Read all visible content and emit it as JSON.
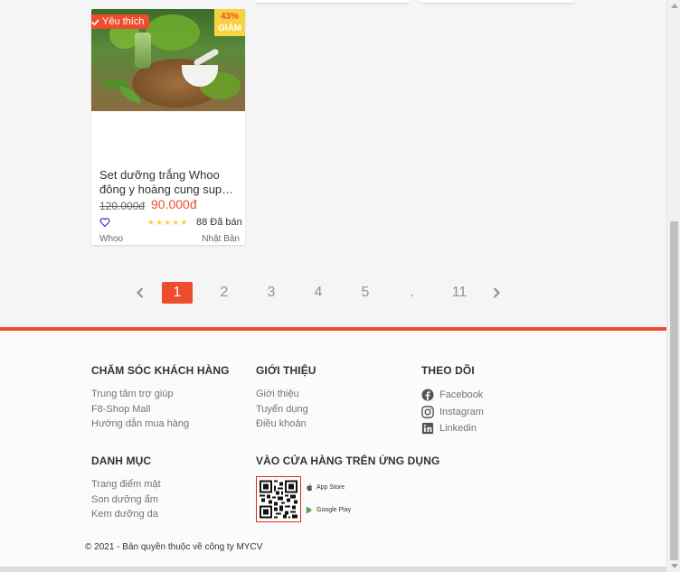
{
  "product": {
    "favorite_badge": "Yêu thích",
    "discount_percent": "43%",
    "discount_label": "GIẢM",
    "name": "Set dưỡng trắng Whoo đông y hoàng cung super sản phẩm",
    "old_price": "120.000đ",
    "new_price": "90.000đ",
    "rating_stars": 5,
    "sold": "88 Đã bán",
    "brand": "Whoo",
    "origin": "Nhật Bản"
  },
  "pagination": {
    "pages": [
      "1",
      "2",
      "3",
      "4",
      "5",
      ".",
      "11"
    ],
    "active_page": "1"
  },
  "footer": {
    "customer_care": {
      "heading": "CHĂM SÓC KHÁCH HÀNG",
      "links": [
        "Trung tâm trợ giúp",
        "F8-Shop Mall",
        "Hướng dẫn mua hàng"
      ]
    },
    "about": {
      "heading": "GIỚI THIỆU",
      "links": [
        "Giới thiệu",
        "Tuyển dụng",
        "Điều khoản"
      ]
    },
    "follow": {
      "heading": "THEO DÕI",
      "links": [
        {
          "label": "Facebook",
          "icon": "facebook-icon"
        },
        {
          "label": "Instagram",
          "icon": "instagram-icon"
        },
        {
          "label": "Linkedin",
          "icon": "linkedin-icon"
        }
      ]
    },
    "categories": {
      "heading": "DANH MỤC",
      "links": [
        "Trang điểm mặt",
        "Son dưỡng ẩm",
        "Kem dưỡng da"
      ]
    },
    "app": {
      "heading": "VÀO CỬA HÀNG TRÊN ỨNG DỤNG",
      "app_store": "App Store",
      "google_play": "Google Play"
    },
    "copyright": "© 2021 - Bản quyền thuộc về công ty MYCV"
  },
  "colors": {
    "accent": "#ee4d2d",
    "star": "#ffce3d",
    "discount_bg": "#ffd840"
  }
}
